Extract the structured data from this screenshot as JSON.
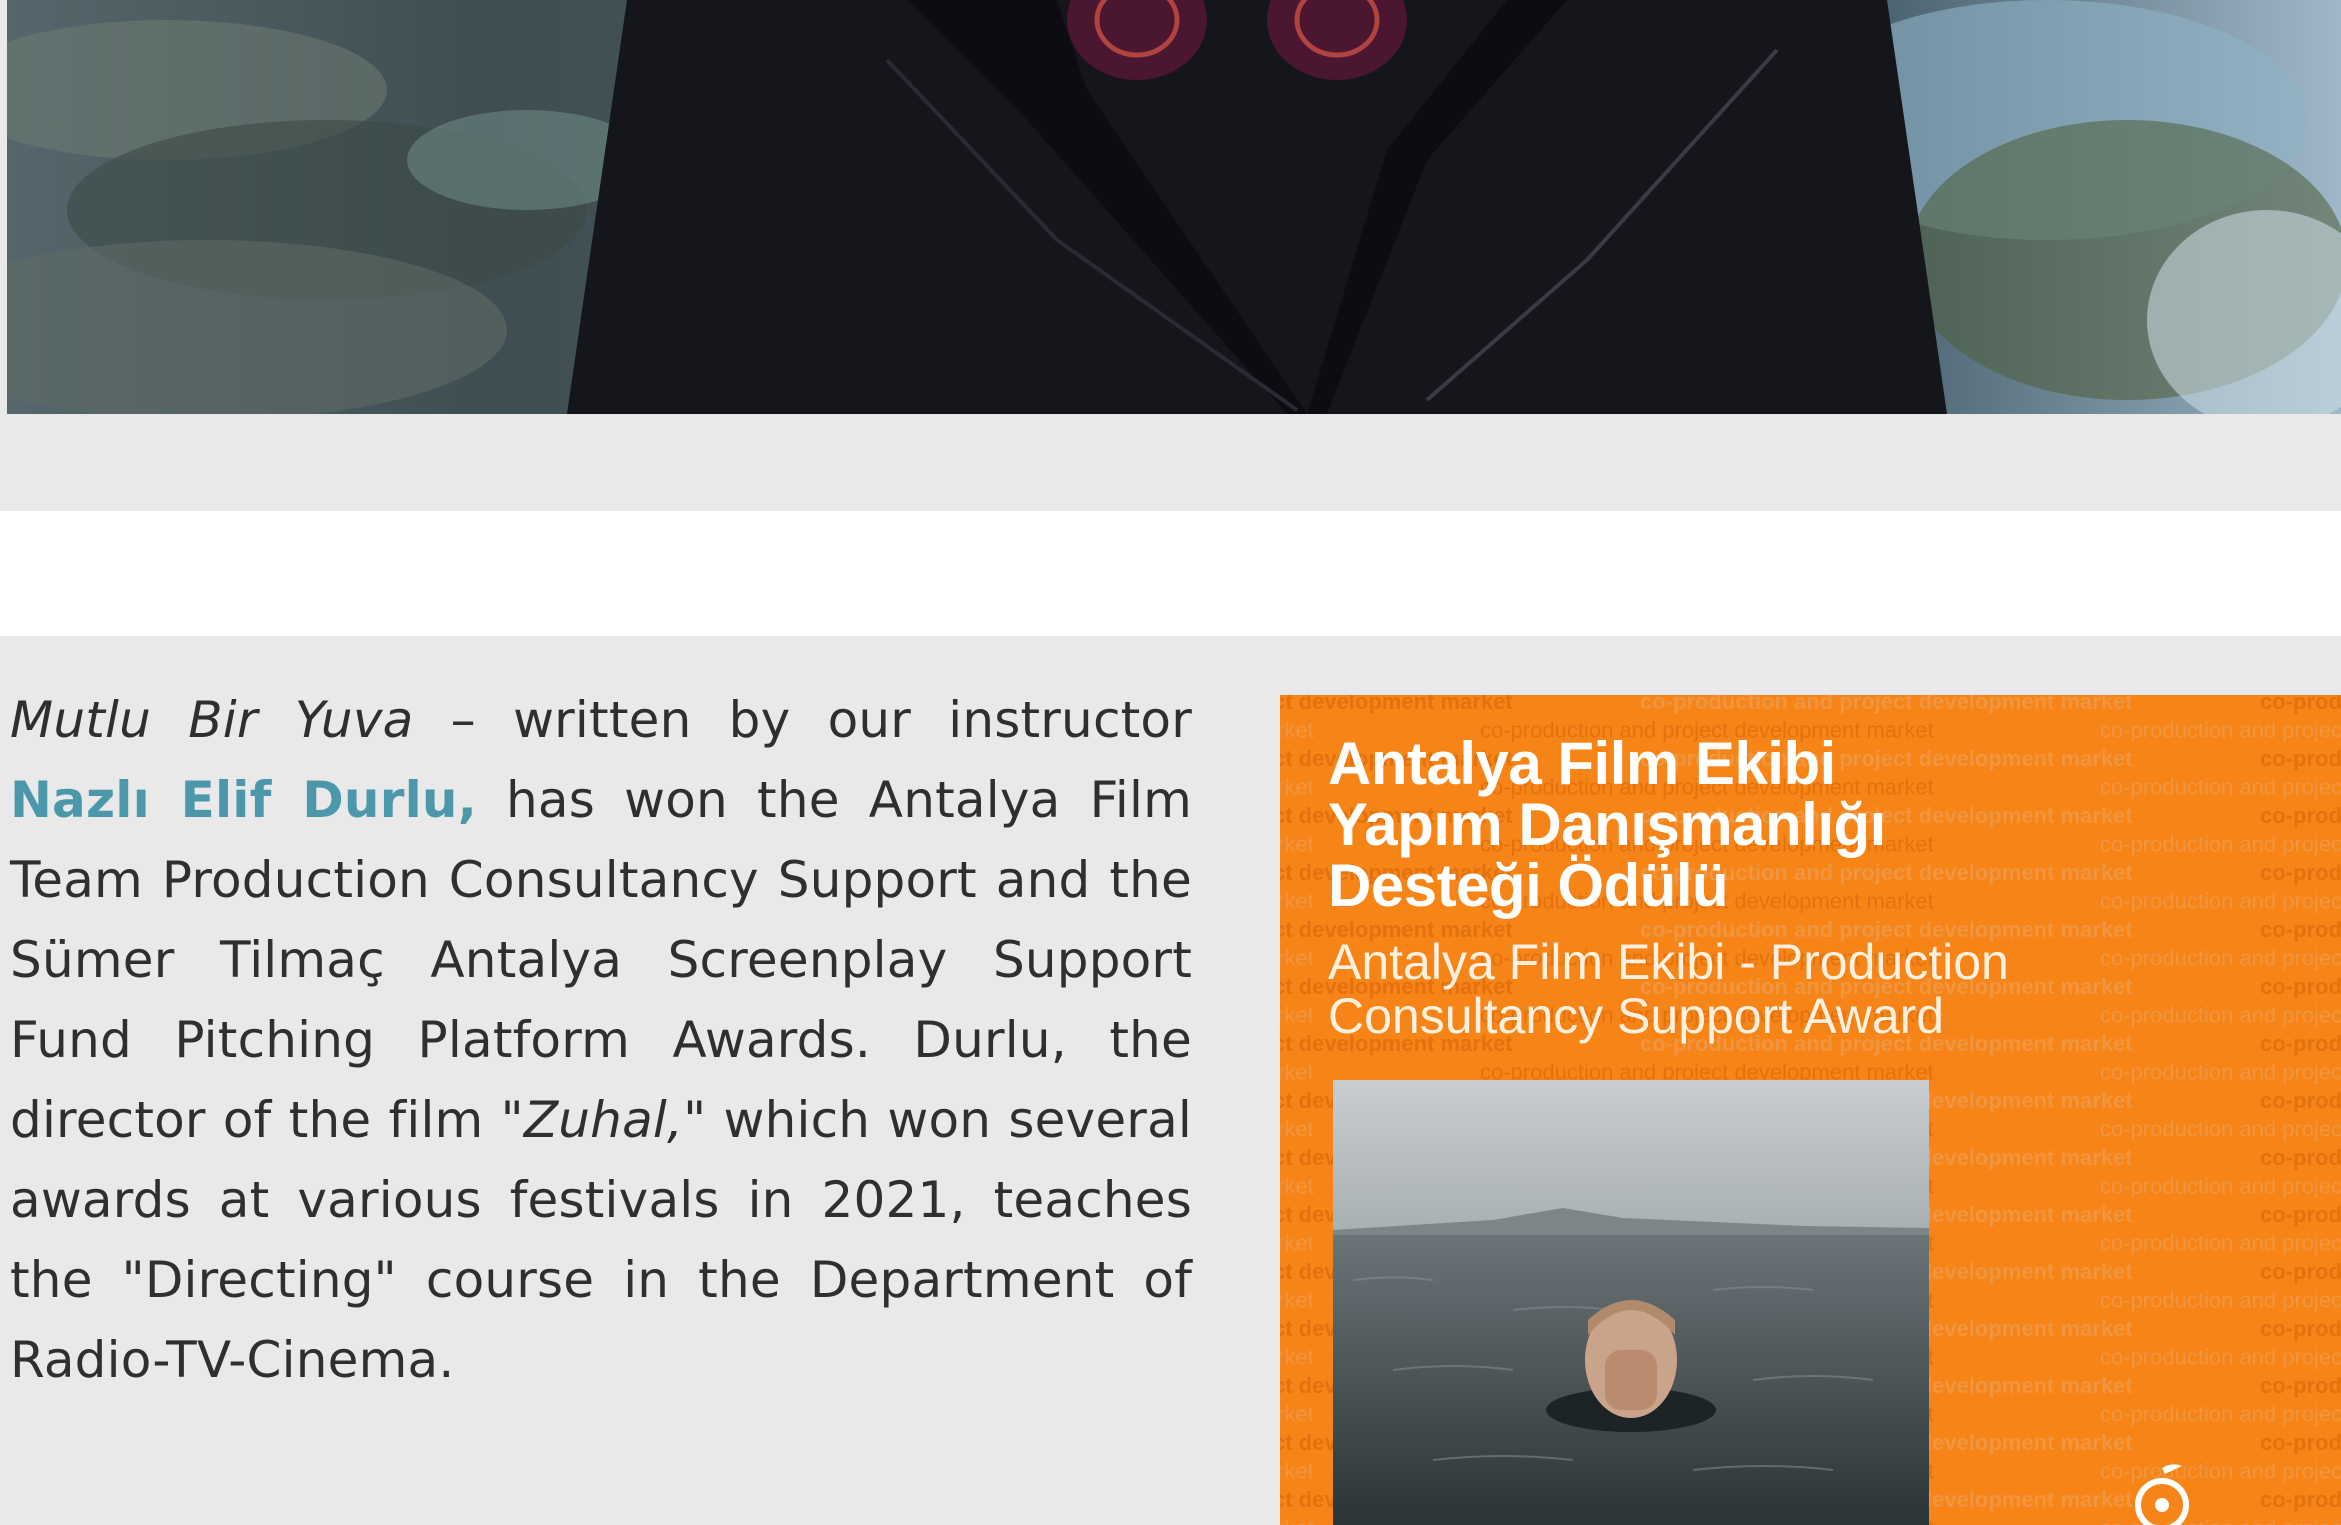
{
  "article": {
    "paragraph": {
      "film_title": "Mutlu Bir Yuva",
      "part1": " – written by our instructor ",
      "instructor_name": "Nazlı Elif Durlu,",
      "part2": " has won the Antalya Film Team Production Consultancy Support and the Sümer Tilmaç Antalya Screenplay Support Fund Pitching Platform Awards. Durlu, the director of the film \"",
      "earlier_film": "Zuhal,",
      "part3": "\" which won several awards at various festivals in 2021, teaches the \"Directing\" course in the Department of Radio-TV-Cinema."
    }
  },
  "poster": {
    "title_tr": "Antalya Film Ekibi\nYapım Danışmanlığı\nDesteği Ödülü",
    "subtitle_en": "Antalya Film Ekibi - Production\nConsultancy Support Award",
    "pattern_text_bold": "co-production and project development market",
    "pattern_text_light": "co-production and project development market"
  },
  "colors": {
    "band_background": "#e9e9e9",
    "highlight_teal": "#4a98aa",
    "body_text": "#2f2f2f",
    "poster_orange": "#f68416"
  },
  "icons": {
    "poster_logo": "festival-orange-logo-icon"
  }
}
